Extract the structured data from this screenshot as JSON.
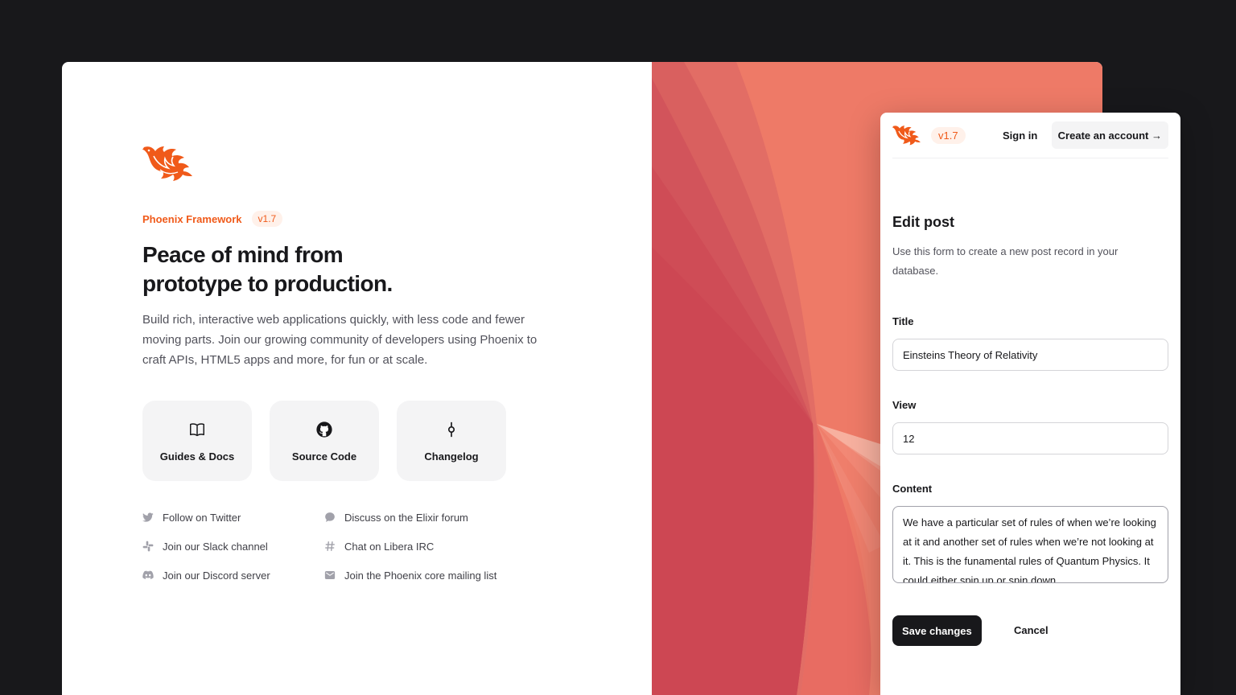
{
  "landing": {
    "brand": "Phoenix Framework",
    "version": "v1.7",
    "headline": "Peace of mind from prototype to production.",
    "lead": "Build rich, interactive web applications quickly, with less code and fewer moving parts. Join our growing community of developers using Phoenix to craft APIs, HTML5 apps and more, for fun or at scale.",
    "tiles": [
      {
        "label": "Guides & Docs",
        "icon": "book-icon"
      },
      {
        "label": "Source Code",
        "icon": "github-icon"
      },
      {
        "label": "Changelog",
        "icon": "commit-icon"
      }
    ],
    "links": [
      {
        "label": "Follow on Twitter",
        "icon": "twitter-icon"
      },
      {
        "label": "Discuss on the Elixir forum",
        "icon": "chat-bubble-icon"
      },
      {
        "label": "Join our Slack channel",
        "icon": "slack-icon"
      },
      {
        "label": "Chat on Libera IRC",
        "icon": "hash-icon"
      },
      {
        "label": "Join our Discord server",
        "icon": "discord-icon"
      },
      {
        "label": "Join the Phoenix core mailing list",
        "icon": "mail-icon"
      }
    ]
  },
  "panel": {
    "version": "v1.7",
    "sign_in": "Sign in",
    "create_account": "Create an account →",
    "form_title": "Edit post",
    "form_description": "Use this form to create a new post record in your database.",
    "fields": {
      "title": {
        "label": "Title",
        "value": "Einsteins Theory of Relativity"
      },
      "view": {
        "label": "View",
        "value": "12"
      },
      "content": {
        "label": "Content",
        "value": "We have a particular set of rules of when we’re looking at it and another set of rules when we’re not looking at it. This is the funamental rules of Quantum Physics. It could either spin up or spin down."
      }
    },
    "save_label": "Save changes",
    "cancel_label": "Cancel"
  },
  "colors": {
    "page_background": "#18181b",
    "accent": "#f05a1a",
    "art_coral": "#ee7a67",
    "art_deep": "#d04a55",
    "button_dark": "#18181b"
  }
}
